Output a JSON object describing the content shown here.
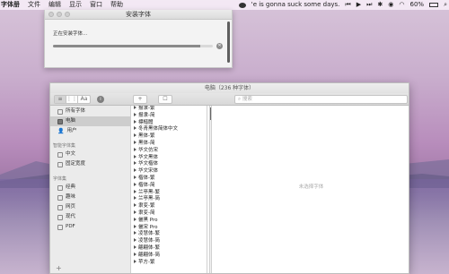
{
  "menubar": {
    "app": "字体册",
    "items": [
      "文件",
      "编辑",
      "显示",
      "窗口",
      "帮助"
    ],
    "now_playing": "'e is gonna suck some days.",
    "battery": "60%"
  },
  "install_dialog": {
    "title": "安装字体",
    "status": "正在安装字体...",
    "progress": 0.92
  },
  "main_window": {
    "title": "电脑（236 种字体）",
    "toolbar": {
      "seg_labels": [
        "≡",
        "⋮⋮",
        "Aa"
      ],
      "info_label": "i",
      "add_label": "+",
      "check_label": "☐",
      "search_placeholder": "搜索"
    },
    "sidebar": {
      "library_items": [
        "所有字体",
        "电脑",
        "用户"
      ],
      "smart_heading": "智能字体集",
      "smart_items": [
        "中文",
        "固定宽度"
      ],
      "collections_heading": "字体集",
      "collection_items": [
        "经典",
        "趣味",
        "网页",
        "现代",
        "PDF"
      ],
      "add_label": "+"
    },
    "font_list": [
      "报隶-繁",
      "报隶-简",
      "標楷體",
      "冬青黑体简体中文",
      "黑体-繁",
      "黑体-简",
      "华文仿宋",
      "华文黑体",
      "华文楷体",
      "华文宋体",
      "楷体-繁",
      "楷体-简",
      "兰亭黑-繁",
      "兰亭黑-简",
      "隶变-繁",
      "隶变-简",
      "儷黑 Pro",
      "儷宋 Pro",
      "凌慧体-繁",
      "凌慧体-简",
      "翩翩体-繁",
      "翩翩体-简",
      "苹方-繁"
    ],
    "preview_empty": "未选择字体"
  }
}
